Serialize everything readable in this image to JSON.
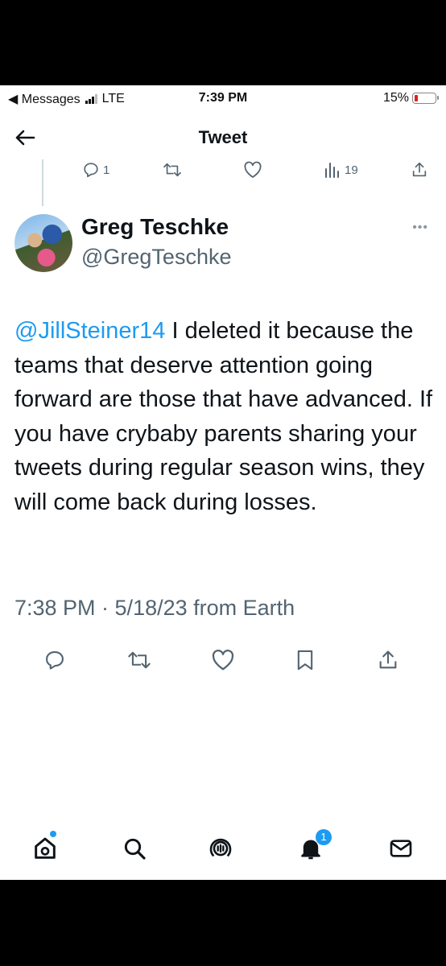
{
  "status": {
    "back_app": "◀ Messages",
    "network": "LTE",
    "time": "7:39 PM",
    "battery": "15%",
    "battery_level": 0.15
  },
  "header": {
    "title": "Tweet"
  },
  "previous_tweet": {
    "reply_count": "1",
    "view_count": "19"
  },
  "tweet": {
    "author_name": "Greg Teschke",
    "author_handle": "@GregTeschke",
    "mention": "@JillSteiner14",
    "text": " I deleted it because the teams that deserve attention going forward are those that have advanced. If you have crybaby parents sharing your tweets during regular season wins, they will come back during losses.",
    "meta": "7:38 PM · 5/18/23 from Earth"
  },
  "nav": {
    "notifications_badge": "1"
  },
  "icons": {
    "reply": "reply-icon",
    "retweet": "retweet-icon",
    "like": "like-icon",
    "views": "views-icon",
    "share": "share-icon",
    "bookmark": "bookmark-icon",
    "home": "home-icon",
    "search": "search-icon",
    "spaces": "spaces-icon",
    "notifications": "bell-icon",
    "messages": "mail-icon",
    "more": "more-icon"
  },
  "colors": {
    "accent": "#1d9bf0",
    "text": "#0f1419",
    "secondary": "#536471"
  }
}
